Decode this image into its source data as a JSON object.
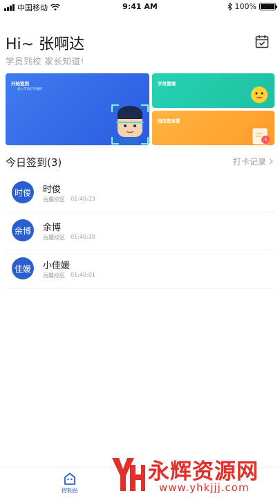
{
  "status_bar": {
    "carrier": "中国移动",
    "time": "9:41 AM",
    "battery": "100%",
    "battery_level": 1.0,
    "icons": [
      "signal-icon",
      "wifi-icon",
      "bluetooth-icon",
      "battery-icon"
    ]
  },
  "header": {
    "greeting": "Hi~ 张啊达",
    "subtitle": "学员到校 家长知道!",
    "calendar_icon": "calendar-check-icon"
  },
  "cards": {
    "checkin": {
      "title": "开始签到",
      "subtitle": "录入学员打卡课程"
    },
    "students": {
      "title": "学员管理"
    },
    "settings": {
      "title": "短信签设置"
    }
  },
  "section": {
    "title": "今日签到(3)",
    "link_label": "打卡记录"
  },
  "checkins": [
    {
      "avatar": "时俊",
      "name": "时俊",
      "campus": "岳麓校区",
      "time": "01:40:23"
    },
    {
      "avatar": "余博",
      "name": "余博",
      "campus": "岳麓校区",
      "time": "01:40:20"
    },
    {
      "avatar": "佳媛",
      "name": "小佳媛",
      "campus": "岳麓校区",
      "time": "01:40:01"
    }
  ],
  "tab_bar": {
    "items": [
      {
        "label": "控制台",
        "icon": "dashboard-icon"
      }
    ]
  },
  "watermark": {
    "text": "永辉资源网",
    "url": "www.yhkjjj.com"
  },
  "colors": {
    "primary": "#2b5fcf",
    "card_blue": "#3f7cf0",
    "card_green": "#26d3b4",
    "card_orange": "#ffb43e",
    "watermark_red": "#e0302b"
  }
}
